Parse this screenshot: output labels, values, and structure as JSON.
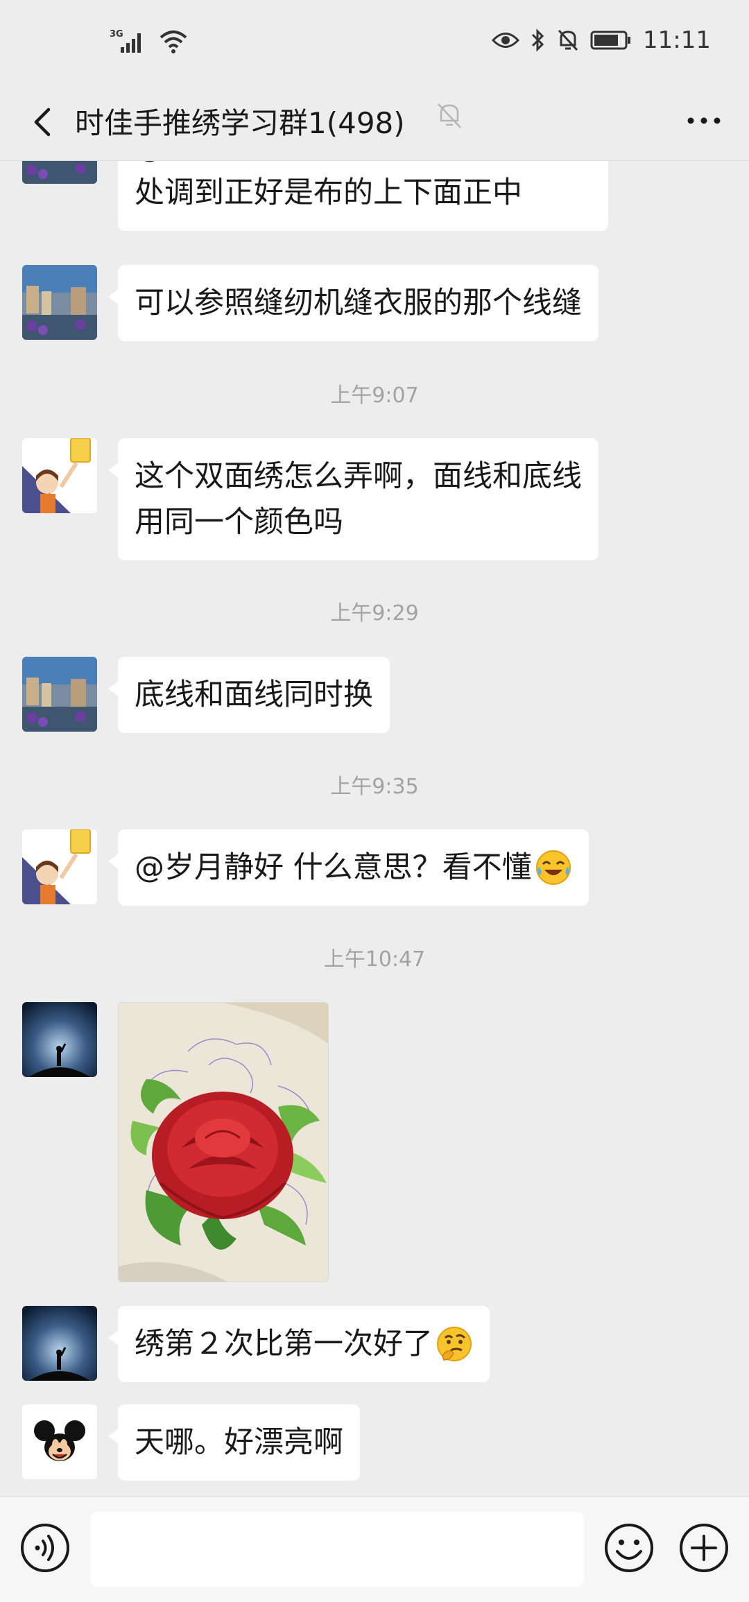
{
  "status_bar": {
    "network": "3G",
    "time": "11:11"
  },
  "header": {
    "title": "时佳手推绣学习群1(498)",
    "icons": [
      "back-arrow-icon",
      "mute-bell-icon",
      "more-icon"
    ]
  },
  "messages": [
    {
      "type": "text",
      "avatar": "town-photo",
      "text_lines": [
        "@是做各种服装 要把二根线的交接",
        "处调到正好是布的上下面正中"
      ]
    },
    {
      "type": "text",
      "avatar": "town-photo",
      "text_lines": [
        "可以参照缝纫机缝衣服的那个线缝"
      ]
    },
    {
      "type": "time",
      "text": "上午9:07"
    },
    {
      "type": "text",
      "avatar": "cartoon-girl",
      "text_lines": [
        "这个双面绣怎么弄啊，面线和底线",
        "用同一个颜色吗"
      ]
    },
    {
      "type": "time",
      "text": "上午9:29"
    },
    {
      "type": "text",
      "avatar": "town-photo",
      "text_lines": [
        "底线和面线同时换"
      ]
    },
    {
      "type": "time",
      "text": "上午9:35"
    },
    {
      "type": "text",
      "avatar": "cartoon-girl",
      "text_lines": [
        "@岁月静好  什么意思？看不懂"
      ],
      "emoji": "laughing-crying-emoji"
    },
    {
      "type": "time",
      "text": "上午10:47"
    },
    {
      "type": "image",
      "avatar": "night-sky",
      "image": "red-rose-embroidery"
    },
    {
      "type": "text",
      "avatar": "night-sky",
      "text_lines": [
        "绣第２次比第一次好了"
      ],
      "emoji": "thinking-emoji"
    },
    {
      "type": "text",
      "avatar": "mickey",
      "text_lines": [
        "天哪。好漂亮啊"
      ]
    }
  ],
  "input_bar": {
    "value": "",
    "icons": [
      "voice-icon",
      "emoji-icon",
      "plus-icon"
    ]
  },
  "colors": {
    "background": "#ededed",
    "bubble": "#ffffff",
    "timestamp": "#a2a2a2"
  }
}
